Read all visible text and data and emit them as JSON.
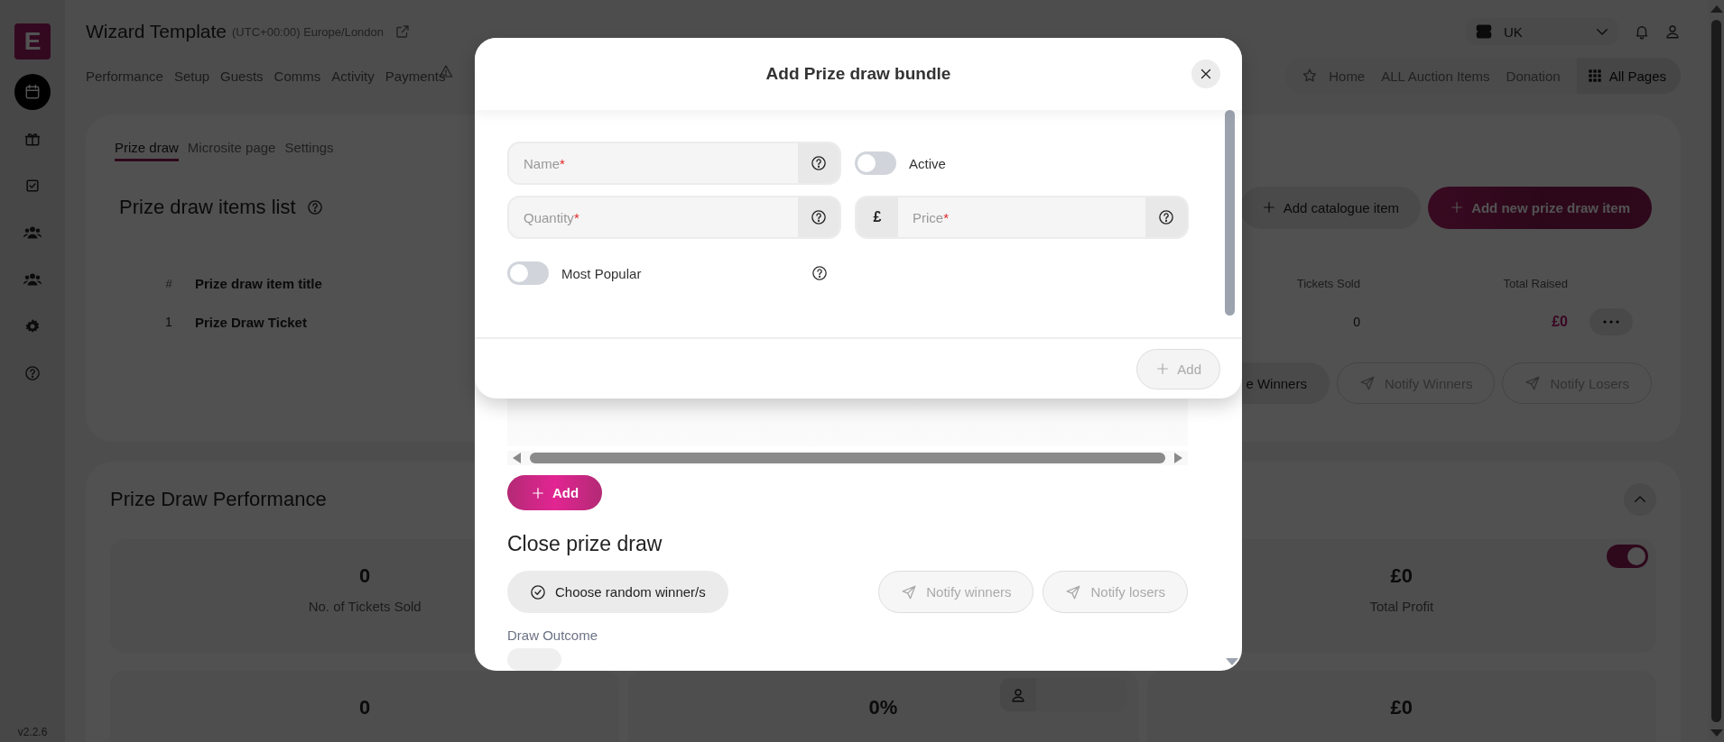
{
  "app": {
    "logo": "E",
    "version": "v2.2.6",
    "sidebar": [
      {
        "selected": true
      },
      {
        "selected": false
      },
      {
        "selected": false
      },
      {
        "selected": false
      },
      {
        "selected": false
      },
      {
        "selected": false
      },
      {
        "selected": false
      }
    ]
  },
  "header": {
    "title": "Wizard Template",
    "timezone": "(UTC+00:00) Europe/London",
    "nav": [
      "Performance",
      "Setup",
      "Guests",
      "Comms",
      "Activity",
      "Payments"
    ],
    "region": "UK"
  },
  "quick_links": {
    "items": [
      "Home",
      "ALL Auction Items",
      "Donation"
    ],
    "all_pages": "All Pages"
  },
  "items_card": {
    "tabs": [
      {
        "label": "Prize draw",
        "selected": true
      },
      {
        "label": "Microsite page",
        "selected": false
      },
      {
        "label": "Settings",
        "selected": false
      }
    ],
    "title": "Prize draw items list",
    "buttons": [
      {
        "label": "Add catalogue item",
        "kind": "secondary"
      },
      {
        "label": "Add new prize draw item",
        "kind": "primary"
      }
    ],
    "columns": [
      "#",
      "Prize draw item title",
      "Tickets Sold",
      "Total Raised"
    ],
    "rows": [
      {
        "index": "1",
        "title": "Prize Draw Ticket",
        "tickets_sold": "0",
        "total_raised": "£0"
      }
    ],
    "actions": [
      {
        "label": "e Winners",
        "disabled": false
      },
      {
        "label": "Notify Winners",
        "disabled": true
      },
      {
        "label": "Notify Losers",
        "disabled": true
      }
    ]
  },
  "performance": {
    "title": "Prize Draw Performance",
    "expanded": true,
    "stats_top": [
      {
        "value": "0",
        "label": "No. of Tickets Sold"
      },
      {
        "value": "£0",
        "label": "Total Profit",
        "toggle_on": true
      }
    ],
    "stats_bottom": [
      {
        "value": "0"
      },
      {
        "value": "0%"
      },
      {
        "value": "£0"
      }
    ]
  },
  "prize_draw_dialog": {
    "add_button": "Add",
    "close_title": "Close prize draw",
    "choose_button": "Choose random winner/s",
    "notify": [
      {
        "label": "Notify winners",
        "disabled": true
      },
      {
        "label": "Notify losers",
        "disabled": true
      }
    ],
    "outcome_label": "Draw Outcome"
  },
  "bundle_dialog": {
    "title": "Add Prize draw bundle",
    "fields": [
      {
        "placeholder": "Name",
        "required_mark": "*"
      },
      {
        "placeholder": "Quantity",
        "required_mark": "*"
      }
    ],
    "active": {
      "label": "Active",
      "on": false
    },
    "price": {
      "prefix": "£",
      "placeholder": "Price",
      "required_mark": "*"
    },
    "most_popular": {
      "label": "Most Popular",
      "on": false
    },
    "submit": {
      "label": "Add",
      "disabled": true
    }
  }
}
